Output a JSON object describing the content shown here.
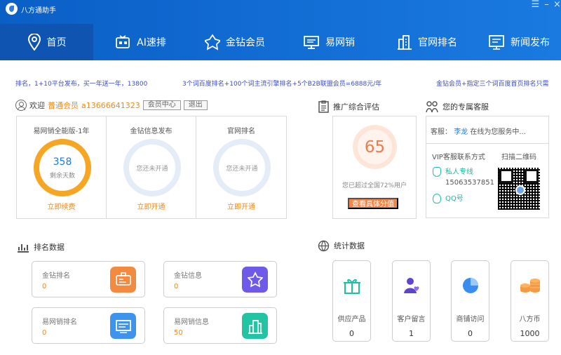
{
  "app": {
    "title": "八方通助手",
    "colors": {
      "primary": "#0a5fc6",
      "accent": "#f08a15",
      "active_nav": "#0f54b0"
    }
  },
  "nav": {
    "items": [
      {
        "label": "首页",
        "icon": "location-pin-icon",
        "active": true
      },
      {
        "label": "AI速排",
        "icon": "robot-icon"
      },
      {
        "label": "金钻会员",
        "icon": "diamond-medal-icon"
      },
      {
        "label": "易网销",
        "icon": "computer-icon"
      },
      {
        "label": "官网排名",
        "icon": "building-icon"
      },
      {
        "label": "新闻发布",
        "icon": "monitor-news-icon"
      }
    ]
  },
  "ticker": [
    "排名，1+10平台发布，买一年送一年，13800",
    "3个词百度排名+100个词主流引擎排名+5个B2B联盟会员=6888元/年",
    "金钻会员+指定三个词百度首页排名只需"
  ],
  "user": {
    "welcome": "欢迎",
    "level": "普通会员",
    "id": "a13666641323",
    "member_center": "会员中心",
    "logout": "退出"
  },
  "products": [
    {
      "title": "易网销全能版-1年",
      "value": "358",
      "value_label": "剩余天数",
      "link": "立即续费"
    },
    {
      "title": "金钻信息发布",
      "empty": "您还未开通",
      "link": "立即开通"
    },
    {
      "title": "官网排名",
      "empty": "您还未开通",
      "link": "立即开通"
    }
  ],
  "score": {
    "section_title": "推广综合评估",
    "value": "65",
    "note": "您已超过全国72%用户",
    "button": "查看具体分值"
  },
  "service": {
    "section_title": "您的专属客服",
    "prefix": "客服：",
    "name": "李龙",
    "status": "在线为您服务中...",
    "vip_title": "VIP客服联系方式",
    "qr_title": "扫描二维码",
    "private_line_label": "私人专线",
    "private_line_value": "15063537851",
    "qq_label": "QQ号"
  },
  "ranking": {
    "section_title": "排名数据",
    "cards": [
      {
        "title": "金钻排名",
        "value": "0",
        "icon": "badge-card-icon",
        "color": "#f48a40"
      },
      {
        "title": "金钻信息",
        "value": "0",
        "icon": "medal-icon",
        "color": "#6d5ae8"
      },
      {
        "title": "易网销排名",
        "value": "0",
        "icon": "web-icon",
        "color": "#3e93ee"
      },
      {
        "title": "易网销信息",
        "value": "50",
        "icon": "chart-building-icon",
        "color": "#22c4a4"
      }
    ]
  },
  "stats": {
    "section_title": "统计数据",
    "cards": [
      {
        "label": "供应产品",
        "value": "0",
        "icon": "gift-icon"
      },
      {
        "label": "客户留言",
        "value": "1",
        "icon": "user-heart-icon"
      },
      {
        "label": "商铺访问",
        "value": "0",
        "icon": "pie-chart-icon"
      },
      {
        "label": "八方币",
        "value": "1000",
        "icon": "coins-icon"
      }
    ]
  }
}
